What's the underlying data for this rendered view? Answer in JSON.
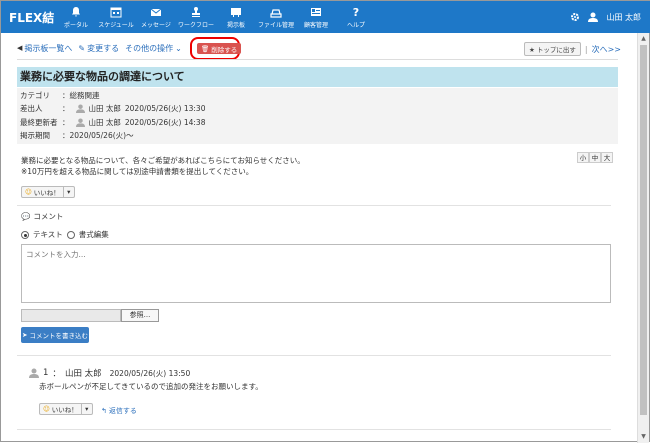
{
  "app": {
    "logo": "FLEX結"
  },
  "nav": [
    {
      "label": "ポータル",
      "icon": "bell-icon"
    },
    {
      "label": "スケジュール",
      "icon": "calendar-icon"
    },
    {
      "label": "メッセージ",
      "icon": "mail-icon"
    },
    {
      "label": "ワークフロー",
      "icon": "stamp-icon"
    },
    {
      "label": "掲示板",
      "icon": "board-icon"
    },
    {
      "label": "ファイル管理",
      "icon": "folder-icon"
    },
    {
      "label": "顧客管理",
      "icon": "card-icon"
    },
    {
      "label": "ヘルプ",
      "icon": "help-icon"
    }
  ],
  "user": {
    "name": "山田 太郎"
  },
  "toolbar": {
    "back": "掲示板一覧へ",
    "edit": "変更する",
    "other": "その他の操作",
    "delete": "削除する",
    "top": "トップに出す",
    "next": "次へ>>"
  },
  "post": {
    "title": "業務に必要な物品の調達について",
    "category_label": "カテゴリ",
    "category": "総務関連",
    "author_label": "差出人",
    "author": "山田 太郎",
    "author_date": "2020/05/26(火) 13:30",
    "updater_label": "最終更新者",
    "updater": "山田 太郎",
    "updater_date": "2020/05/26(火) 14:38",
    "period_label": "掲示期間",
    "period": "2020/05/26(火)〜",
    "body_line1": "業務に必要となる物品について、各々ご希望があればこちらにてお知らせください。",
    "body_line2": "※10万円を超える物品に関しては別途申請書類を提出してください。"
  },
  "font_sizes": [
    "小",
    "中",
    "大"
  ],
  "like": {
    "label": "いいね！"
  },
  "comments": {
    "heading": "コメント",
    "mode_text": "テキスト",
    "mode_rich": "書式編集",
    "placeholder": "コメントを入力...",
    "browse": "参照...",
    "submit": "コメントを書き込む"
  },
  "reply": {
    "number": "1",
    "author": "山田 太郎",
    "date": "2020/05/26(火) 13:50",
    "text": "赤ボールペンが不足してきているので追加の発注をお願いします。",
    "reply_link": "返信する"
  }
}
